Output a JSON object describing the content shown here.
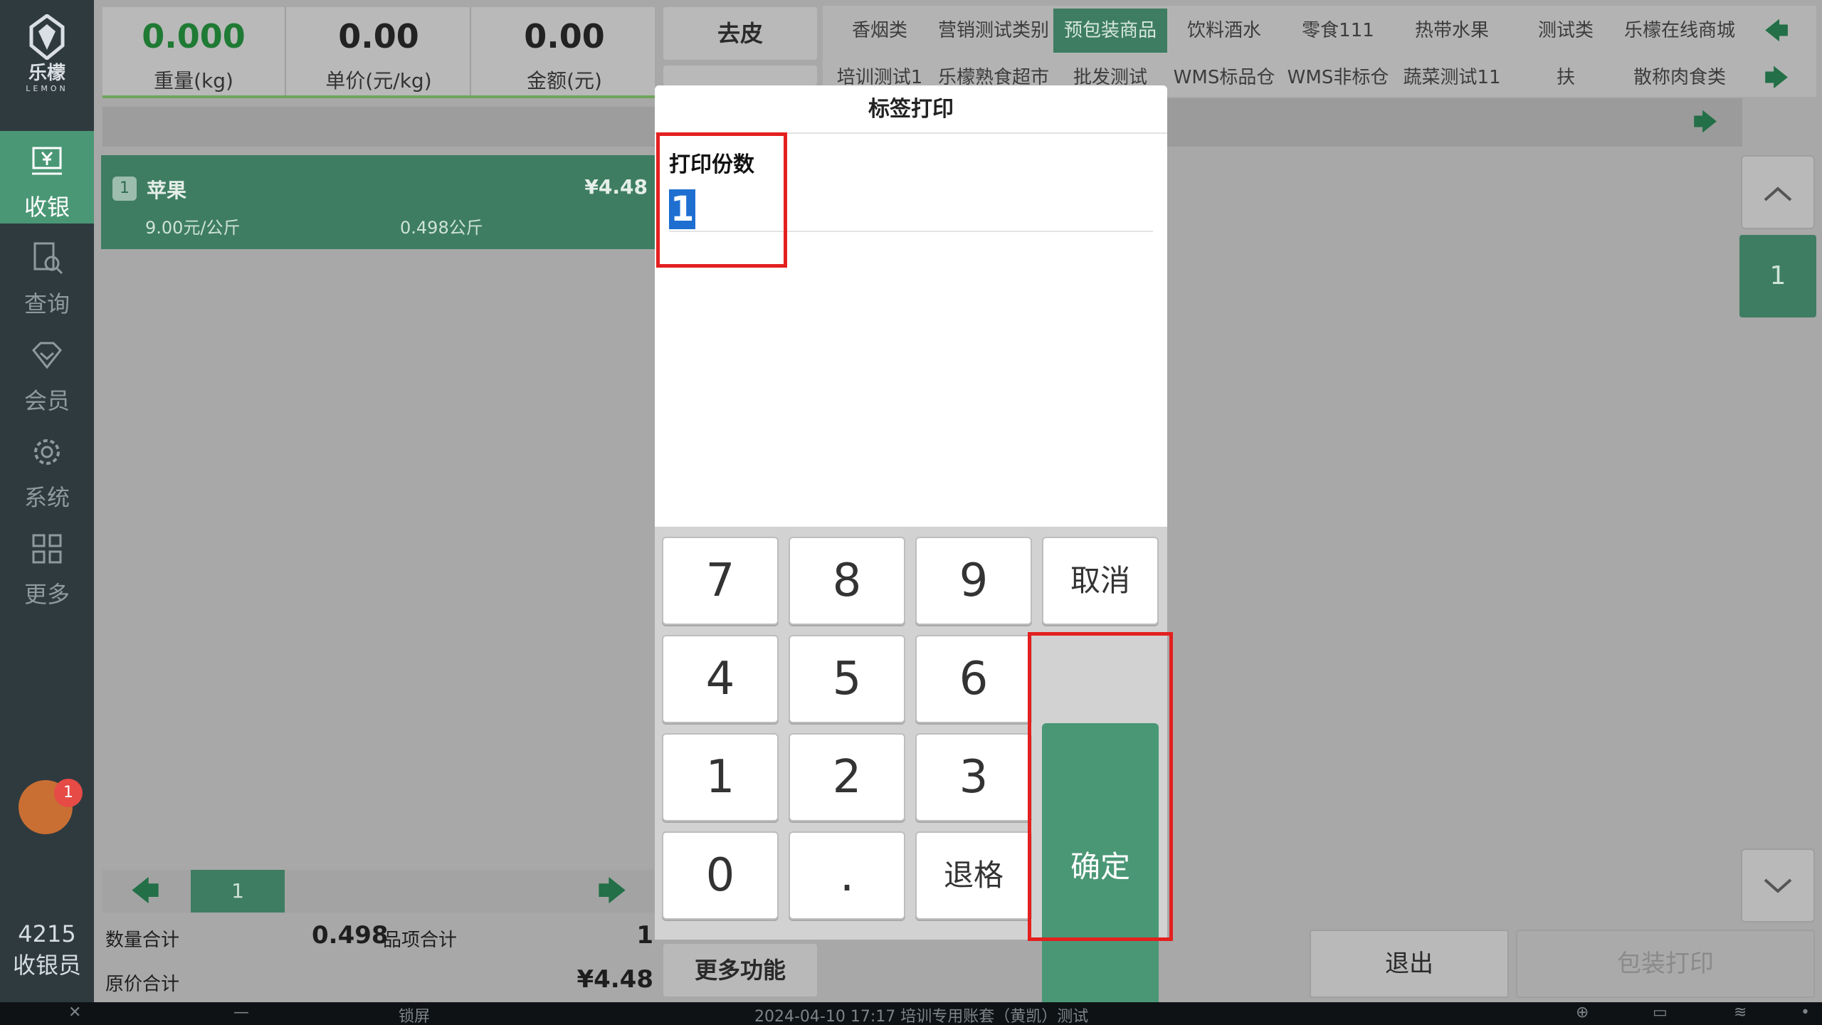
{
  "brand": {
    "name": "乐檬",
    "en": "LEMON"
  },
  "nav": [
    {
      "id": "cashier",
      "label": "收银",
      "active": true
    },
    {
      "id": "query",
      "label": "查询",
      "active": false
    },
    {
      "id": "member",
      "label": "会员",
      "active": false
    },
    {
      "id": "system",
      "label": "系统",
      "active": false
    },
    {
      "id": "more",
      "label": "更多",
      "active": false
    }
  ],
  "notification_count": "1",
  "cashier": {
    "id": "4215",
    "role": "收银员"
  },
  "scale": [
    {
      "value": "0.000",
      "label": "重量(kg)"
    },
    {
      "value": "0.00",
      "label": "单价(元/kg)"
    },
    {
      "value": "0.00",
      "label": "金额(元)"
    }
  ],
  "cart_item": {
    "index": "1",
    "name": "苹果",
    "price": "¥4.48",
    "unit_price": "9.00元/公斤",
    "qty": "0.498公斤"
  },
  "pager": {
    "current": "1",
    "prev": "🡄",
    "next": "🡆"
  },
  "totals": {
    "qty_label": "数量合计",
    "qty_value": "0.498",
    "items_label": "品项合计",
    "items_value": "1",
    "orig_label": "原价合计",
    "orig_value": "¥4.48"
  },
  "middle": {
    "tare": "去皮",
    "more": "更多功能"
  },
  "categories": {
    "row1": [
      "香烟类",
      "营销测试类别",
      "预包装商品",
      "饮料酒水",
      "零食111",
      "热带水果",
      "测试类",
      "乐檬在线商城"
    ],
    "row2": [
      "培训测试1",
      "乐檬熟食超市",
      "批发测试",
      "WMS标品仓",
      "WMS非标仓",
      "蔬菜测试11",
      "扶",
      "散称肉食类"
    ],
    "active": "预包装商品"
  },
  "right_page": "1",
  "bottom": {
    "exit": "退出",
    "pack_print": "包装打印"
  },
  "dialog": {
    "title": "标签打印",
    "field_label": "打印份数",
    "field_value": "1",
    "keys": [
      "7",
      "8",
      "9",
      "4",
      "5",
      "6",
      "1",
      "2",
      "3",
      "0",
      "."
    ],
    "cancel": "取消",
    "backspace": "退格",
    "confirm": "确定"
  },
  "taskbar": {
    "lock": "锁屏",
    "status": "2024-04-10 17:17 培训专用账套（黄凯）测试"
  }
}
